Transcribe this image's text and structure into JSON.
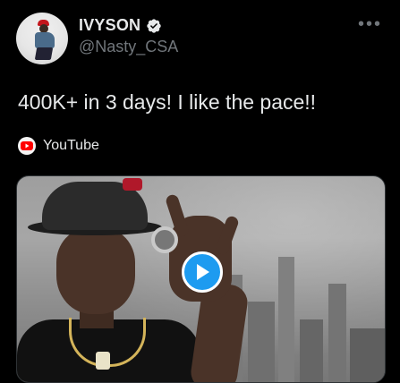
{
  "tweet": {
    "display_name": "IVYSON",
    "handle": "@Nasty_CSA",
    "text": "400K+ in 3 days! I like the pace!!",
    "more_glyph": "•••",
    "verified_icon": "verified-badge-icon"
  },
  "link_source": {
    "label": "YouTube",
    "icon": "youtube-logo-icon"
  },
  "media": {
    "play_icon": "play-icon"
  },
  "colors": {
    "background": "#000000",
    "text": "#e7e9ea",
    "secondary_text": "#71767b",
    "accent": "#1d9bf0",
    "youtube_red": "#ff0000"
  }
}
